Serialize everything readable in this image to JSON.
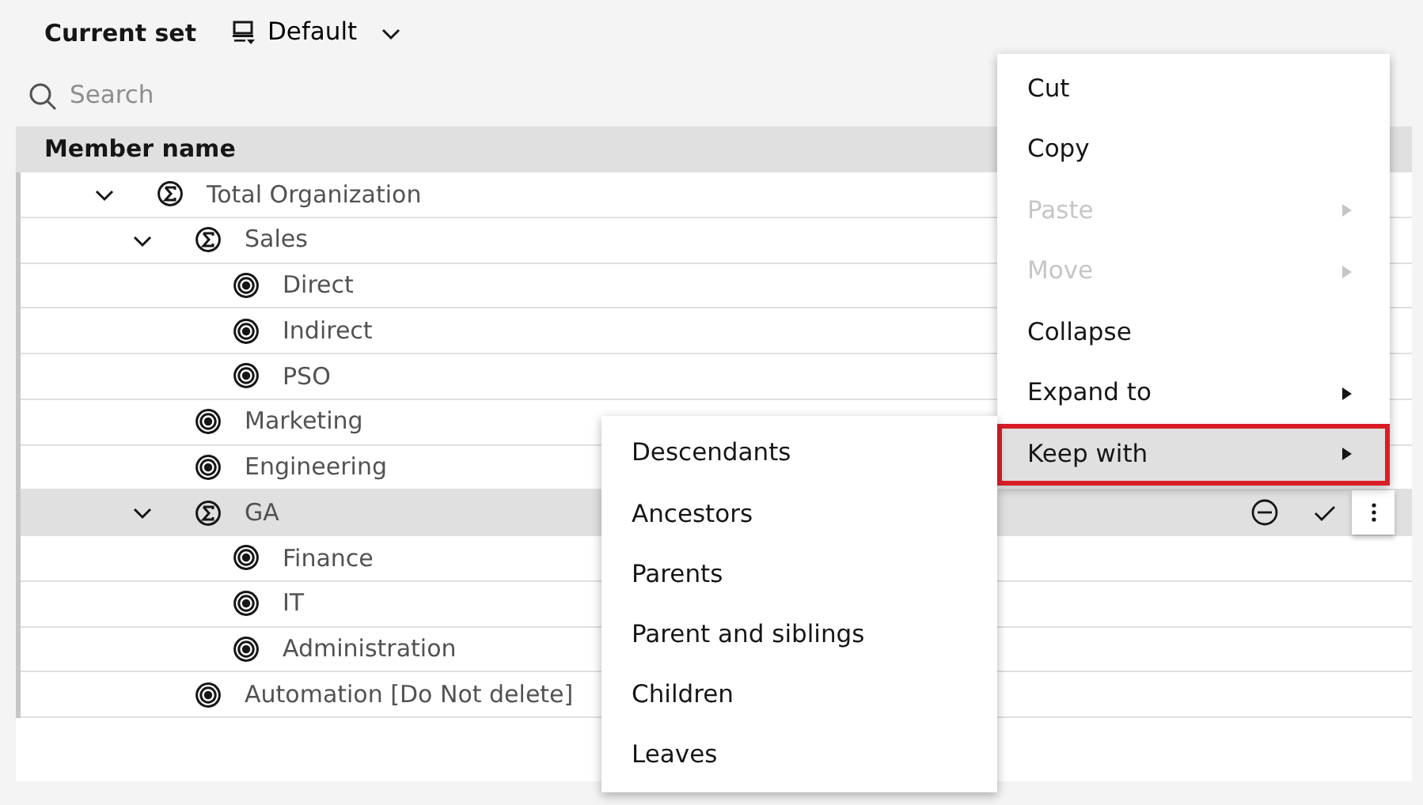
{
  "header": {
    "title": "Current set",
    "set_name": "Default"
  },
  "search": {
    "placeholder": "Search"
  },
  "table": {
    "columns": [
      "Member name"
    ],
    "rows": [
      {
        "label": "Total Organization",
        "kind": "consolidated",
        "expanded": true,
        "selected": false,
        "children": [
          {
            "label": "Sales",
            "kind": "consolidated",
            "expanded": true,
            "selected": false,
            "children": [
              {
                "label": "Direct",
                "kind": "leaf",
                "selected": false
              },
              {
                "label": "Indirect",
                "kind": "leaf",
                "selected": false
              },
              {
                "label": "PSO",
                "kind": "leaf",
                "selected": false
              }
            ]
          },
          {
            "label": "Marketing",
            "kind": "leaf",
            "selected": false
          },
          {
            "label": "Engineering",
            "kind": "leaf",
            "selected": false
          },
          {
            "label": "GA",
            "kind": "consolidated",
            "expanded": true,
            "selected": true,
            "children": [
              {
                "label": "Finance",
                "kind": "leaf",
                "selected": false
              },
              {
                "label": "IT",
                "kind": "leaf",
                "selected": false
              },
              {
                "label": "Administration",
                "kind": "leaf",
                "selected": false
              }
            ]
          },
          {
            "label": "Automation [Do Not delete]",
            "kind": "leaf",
            "selected": false
          }
        ]
      }
    ]
  },
  "context_menu": {
    "items": [
      {
        "label": "Cut",
        "disabled": false,
        "submenu": false,
        "selected": false,
        "outlined": false
      },
      {
        "label": "Copy",
        "disabled": false,
        "submenu": false,
        "selected": false,
        "outlined": false
      },
      {
        "label": "Paste",
        "disabled": true,
        "submenu": true,
        "selected": false,
        "outlined": false
      },
      {
        "label": "Move",
        "disabled": true,
        "submenu": true,
        "selected": false,
        "outlined": false
      },
      {
        "label": "Collapse",
        "disabled": false,
        "submenu": false,
        "selected": false,
        "outlined": false
      },
      {
        "label": "Expand to",
        "disabled": false,
        "submenu": true,
        "selected": false,
        "outlined": false
      },
      {
        "label": "Keep with",
        "disabled": false,
        "submenu": true,
        "selected": true,
        "outlined": true
      }
    ]
  },
  "submenu": {
    "items": [
      "Descendants",
      "Ancestors",
      "Parents",
      "Parent and siblings",
      "Children",
      "Leaves"
    ]
  }
}
